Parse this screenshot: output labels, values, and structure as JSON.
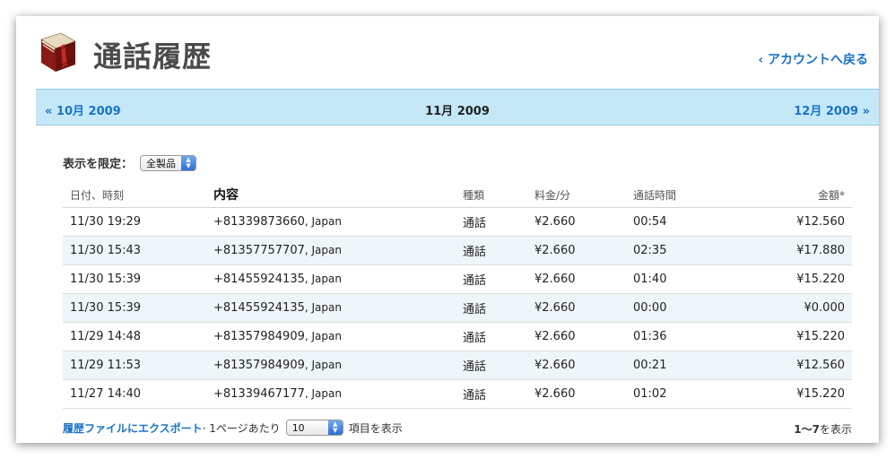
{
  "header": {
    "title": "通話履歴",
    "back_link": "‹ アカウントへ戻る"
  },
  "monthbar": {
    "prev": "« 10月 2009",
    "current": "11月 2009",
    "next": "12月 2009 »"
  },
  "filter": {
    "label": "表示を限定：",
    "selected": "全製品"
  },
  "table": {
    "headers": [
      "日付、時刻",
      "内容",
      "種類",
      "料金/分",
      "通話時間",
      "金額*"
    ],
    "rows": [
      {
        "datetime": "11/30 19:29",
        "number": "+81339873660",
        "country": ", Japan",
        "type": "通話",
        "rate": "¥2.660",
        "duration": "00:54",
        "amount": "¥12.560"
      },
      {
        "datetime": "11/30 15:43",
        "number": "+81357757707",
        "country": ", Japan",
        "type": "通話",
        "rate": "¥2.660",
        "duration": "02:35",
        "amount": "¥17.880"
      },
      {
        "datetime": "11/30 15:39",
        "number": "+81455924135",
        "country": ", Japan",
        "type": "通話",
        "rate": "¥2.660",
        "duration": "01:40",
        "amount": "¥15.220"
      },
      {
        "datetime": "11/30 15:39",
        "number": "+81455924135",
        "country": ", Japan",
        "type": "通話",
        "rate": "¥2.660",
        "duration": "00:00",
        "amount": "¥0.000"
      },
      {
        "datetime": "11/29 14:48",
        "number": "+81357984909",
        "country": ", Japan",
        "type": "通話",
        "rate": "¥2.660",
        "duration": "01:36",
        "amount": "¥15.220"
      },
      {
        "datetime": "11/29 11:53",
        "number": "+81357984909",
        "country": ", Japan",
        "type": "通話",
        "rate": "¥2.660",
        "duration": "00:21",
        "amount": "¥12.560"
      },
      {
        "datetime": "11/27 14:40",
        "number": "+81339467177",
        "country": ", Japan",
        "type": "通話",
        "rate": "¥2.660",
        "duration": "01:02",
        "amount": "¥15.220"
      }
    ]
  },
  "footer": {
    "export_link": "履歴ファイルにエクスポート",
    "per_page_prefix": " · 1ページあたり",
    "per_page_value": "10",
    "per_page_suffix": "項目を表示",
    "range": "1〜7",
    "range_suffix": "を表示"
  },
  "colors": {
    "link": "#1a73c8",
    "monthbar_bg": "#c5e8f8",
    "alt_row_bg": "#eef6fa"
  },
  "icons": {
    "app_icon": "red-book-icon"
  }
}
